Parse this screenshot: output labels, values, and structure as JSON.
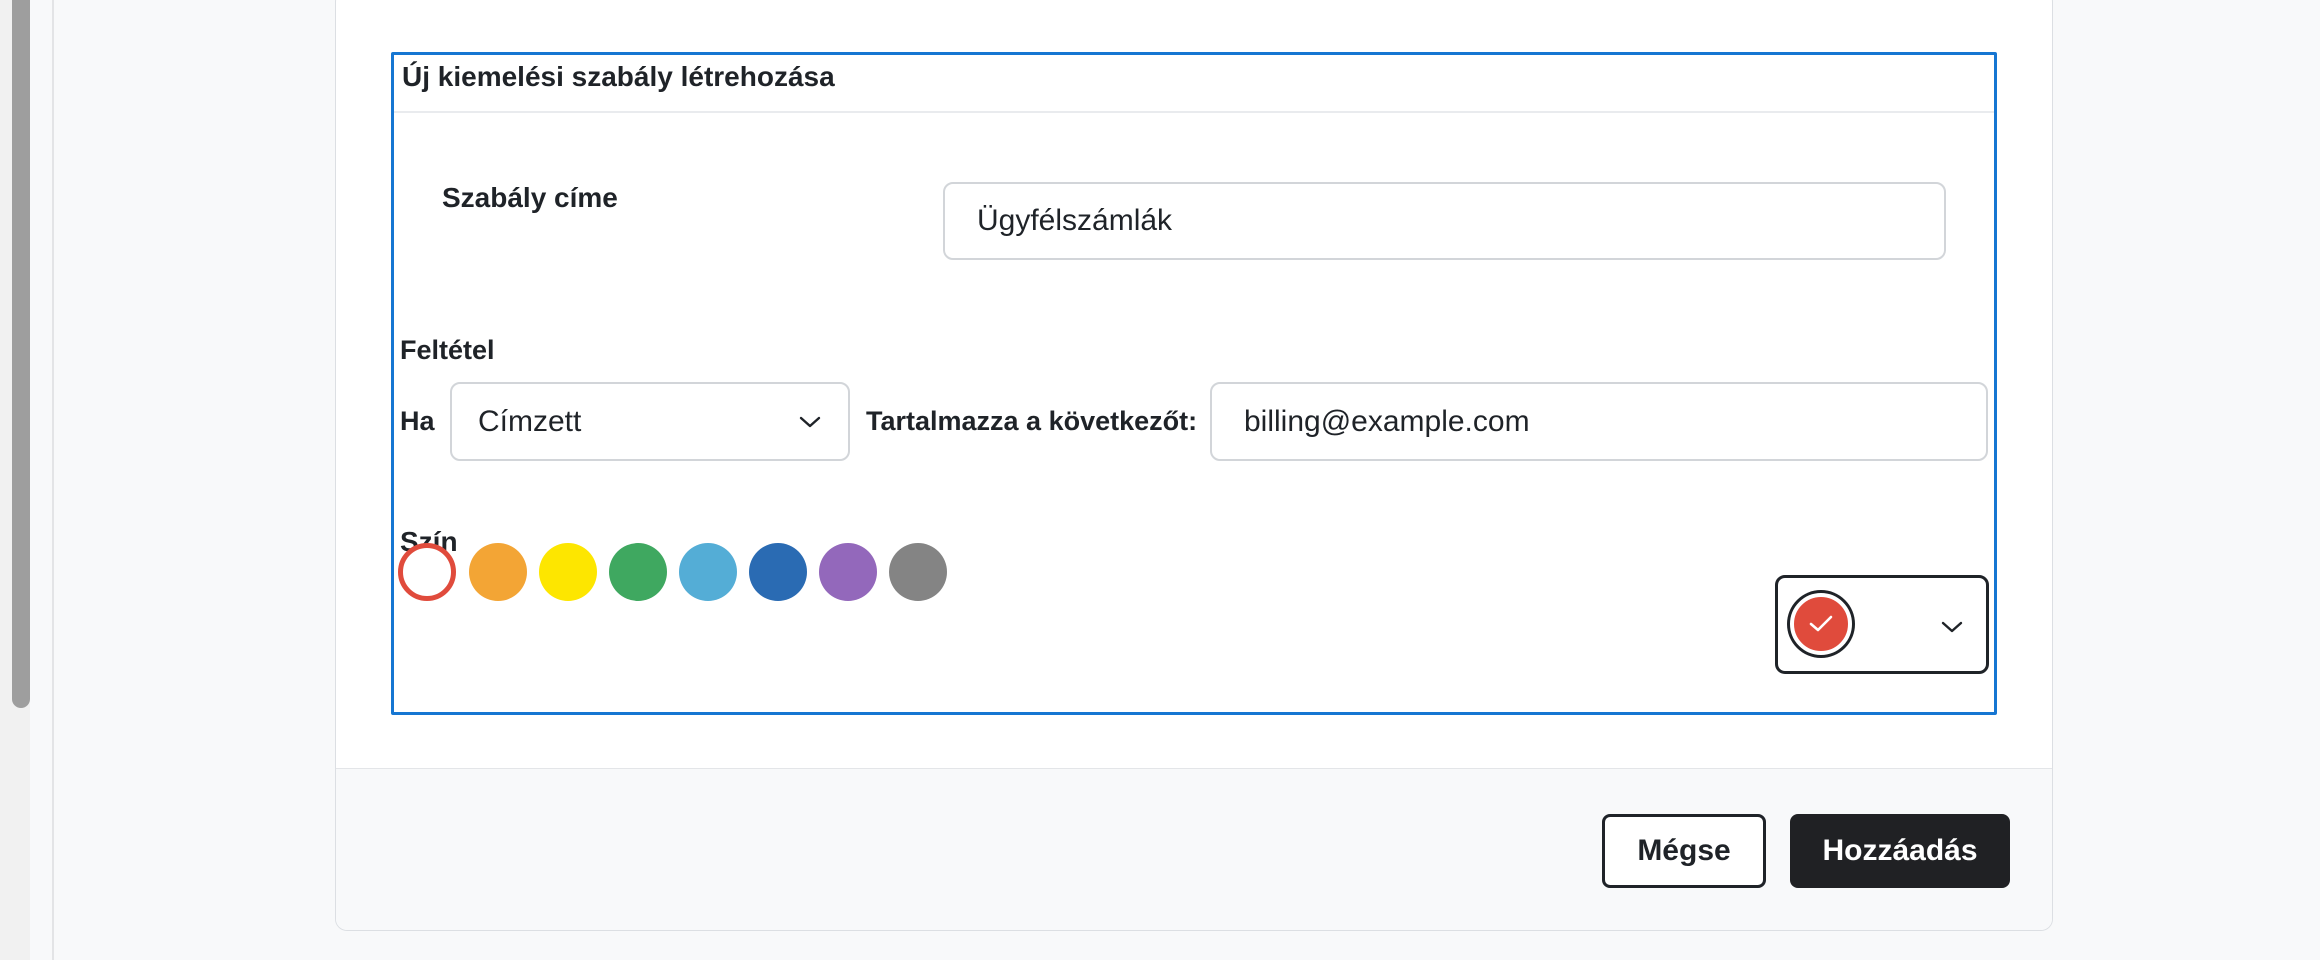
{
  "rule_form": {
    "heading": "Új kiemelési szabály létrehozása",
    "title_label": "Szabály címe",
    "title_value": "Ügyfélszámlák",
    "condition_heading": "Feltétel",
    "if_label": "Ha",
    "field_select_value": "Címzett",
    "contains_label": "Tartalmazza a következőt:",
    "contains_value": "billing@example.com",
    "color_heading": "Szín",
    "swatches": [
      {
        "name": "red",
        "color": "#e04b3c",
        "selected": true
      },
      {
        "name": "orange",
        "color": "#f3a535"
      },
      {
        "name": "yellow",
        "color": "#fde600"
      },
      {
        "name": "green",
        "color": "#3fa860"
      },
      {
        "name": "light-blue",
        "color": "#54add6"
      },
      {
        "name": "blue",
        "color": "#2a6bb3"
      },
      {
        "name": "purple",
        "color": "#9368bb"
      },
      {
        "name": "gray",
        "color": "#848484"
      }
    ],
    "color_picker": {
      "selected_color": "#e04b3c",
      "icon": "check-icon"
    }
  },
  "footer": {
    "cancel_label": "Mégse",
    "add_label": "Hozzáadás"
  },
  "colors": {
    "focus_border": "#1676d2",
    "primary_button": "#202124"
  }
}
